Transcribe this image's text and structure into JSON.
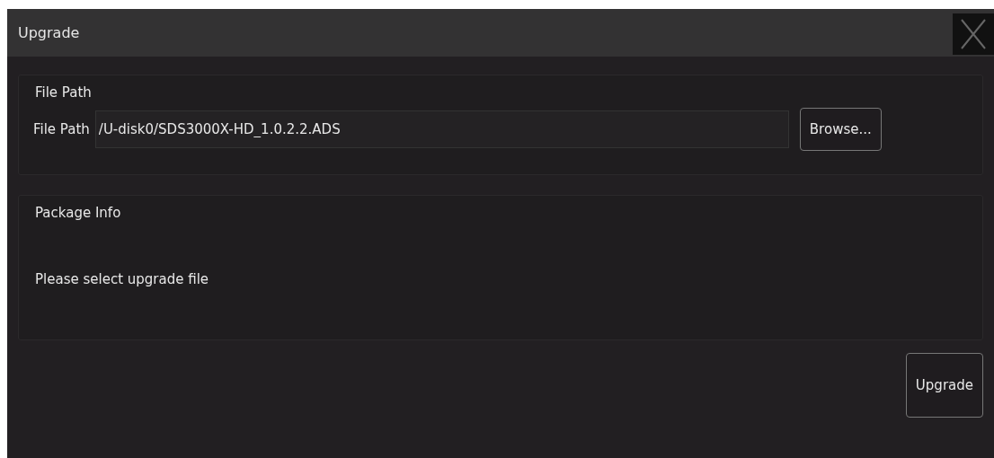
{
  "window": {
    "title": "Upgrade"
  },
  "file_path_group": {
    "legend": "File Path",
    "label": "File Path",
    "value": "/U-disk0/SDS3000X-HD_1.0.2.2.ADS",
    "browse_button": "Browse..."
  },
  "package_info_group": {
    "legend": "Package Info",
    "message": "Please select upgrade file"
  },
  "upgrade_button": "Upgrade"
}
